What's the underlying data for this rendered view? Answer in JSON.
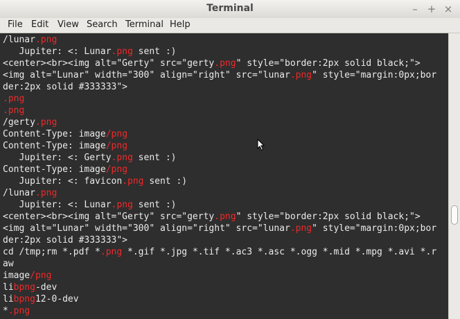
{
  "window": {
    "title": "Terminal",
    "min_glyph": "–",
    "max_glyph": "+",
    "close_glyph": "×"
  },
  "menubar": {
    "items": [
      "File",
      "Edit",
      "View",
      "Search",
      "Terminal",
      "Help"
    ]
  },
  "colors": {
    "highlight": "#ef2929",
    "text": "#ebebeb",
    "background": "#2e2e2e"
  },
  "terminal": {
    "lines": [
      [
        [
          "/lunar",
          ""
        ],
        [
          ".png",
          "r"
        ]
      ],
      [
        [
          "   Jupiter: <: Lunar",
          ""
        ],
        [
          ".png",
          "r"
        ],
        [
          " sent :)",
          ""
        ]
      ],
      [
        [
          "<center><br><img alt=\"Gerty\" src=\"gerty",
          ""
        ],
        [
          ".png",
          "r"
        ],
        [
          "\" style=\"border:2px solid black;\">",
          ""
        ]
      ],
      [
        [
          "<img alt=\"Lunar\" width=\"300\" align=\"right\" src=\"lunar",
          ""
        ],
        [
          ".png",
          "r"
        ],
        [
          "\" style=\"margin:0px;bor",
          ""
        ]
      ],
      [
        [
          "der:2px solid #333333\">",
          ""
        ]
      ],
      [
        [
          ".png",
          "r"
        ]
      ],
      [
        [
          ".png",
          "r"
        ]
      ],
      [
        [
          "/gerty",
          ""
        ],
        [
          ".png",
          "r"
        ]
      ],
      [
        [
          "Content-Type: image",
          ""
        ],
        [
          "/png",
          "r"
        ]
      ],
      [
        [
          "Content-Type: image",
          ""
        ],
        [
          "/png",
          "r"
        ]
      ],
      [
        [
          "   Jupiter: <: Gerty",
          ""
        ],
        [
          ".png",
          "r"
        ],
        [
          " sent :)",
          ""
        ]
      ],
      [
        [
          "Content-Type: image",
          ""
        ],
        [
          "/png",
          "r"
        ]
      ],
      [
        [
          "   Jupiter: <: favicon",
          ""
        ],
        [
          ".png",
          "r"
        ],
        [
          " sent :)",
          ""
        ]
      ],
      [
        [
          "/lunar",
          ""
        ],
        [
          ".png",
          "r"
        ]
      ],
      [
        [
          "   Jupiter: <: Lunar",
          ""
        ],
        [
          ".png",
          "r"
        ],
        [
          " sent :)",
          ""
        ]
      ],
      [
        [
          "<center><br><img alt=\"Gerty\" src=\"gerty",
          ""
        ],
        [
          ".png",
          "r"
        ],
        [
          "\" style=\"border:2px solid black;\">",
          ""
        ]
      ],
      [
        [
          "<img alt=\"Lunar\" width=\"300\" align=\"right\" src=\"lunar",
          ""
        ],
        [
          ".png",
          "r"
        ],
        [
          "\" style=\"margin:0px;bor",
          ""
        ]
      ],
      [
        [
          "der:2px solid #333333\">",
          ""
        ]
      ],
      [
        [
          "cd /tmp;rm *.pdf *",
          ""
        ],
        [
          ".png",
          "r"
        ],
        [
          " *.gif *.jpg *.tif *.ac3 *.asc *.ogg *.mid *.mpg *.avi *.r",
          ""
        ]
      ],
      [
        [
          "aw",
          ""
        ]
      ],
      [
        [
          "image",
          ""
        ],
        [
          "/png",
          "r"
        ]
      ],
      [
        [
          "li",
          ""
        ],
        [
          "bpng",
          "r"
        ],
        [
          "-dev",
          ""
        ]
      ],
      [
        [
          "li",
          ""
        ],
        [
          "bpng",
          "r"
        ],
        [
          "12-0-dev",
          ""
        ]
      ],
      [
        [
          "*",
          ""
        ],
        [
          ".png",
          "r"
        ]
      ]
    ]
  }
}
